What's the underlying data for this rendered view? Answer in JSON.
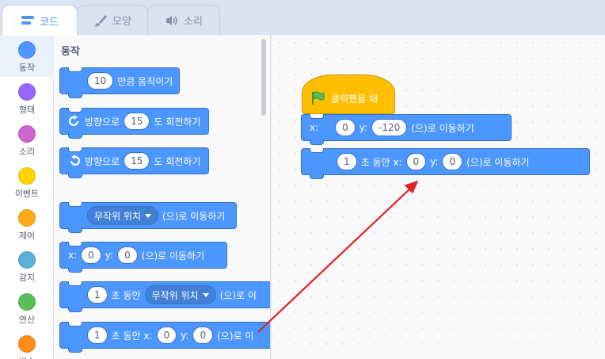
{
  "tabs": [
    {
      "label": "코드",
      "icon": "code-icon"
    },
    {
      "label": "모양",
      "icon": "brush-icon"
    },
    {
      "label": "소리",
      "icon": "speaker-icon"
    }
  ],
  "categories": [
    {
      "label": "동작",
      "color": "#4c97ff"
    },
    {
      "label": "형태",
      "color": "#9966ff"
    },
    {
      "label": "소리",
      "color": "#cf63cf"
    },
    {
      "label": "이벤트",
      "color": "#ffd500"
    },
    {
      "label": "제어",
      "color": "#ffab19"
    },
    {
      "label": "감지",
      "color": "#5cb1d6"
    },
    {
      "label": "연산",
      "color": "#59c059"
    },
    {
      "label": "변수",
      "color": "#ff8c1a"
    }
  ],
  "palette": {
    "title": "동작",
    "move": {
      "value": "10",
      "text": "만큼 움직이기"
    },
    "turn_right": {
      "pre": "방향으로",
      "value": "15",
      "post": "도 회전하기"
    },
    "turn_left": {
      "pre": "방향으로",
      "value": "15",
      "post": "도 회전하기"
    },
    "goto_random": {
      "dropdown": "무작위 위치",
      "post": "(으)로 이동하기"
    },
    "goto_xy": {
      "x_label": "x:",
      "x": "0",
      "y_label": "y:",
      "y": "0",
      "post": "(으)로 이동하기"
    },
    "glide_random": {
      "value": "1",
      "mid": "초 동안",
      "dropdown": "무작위 위치",
      "post": "(으)로 이"
    },
    "glide_xy": {
      "value": "1",
      "mid": "초 동안 x:",
      "x": "0",
      "y_label": "y:",
      "y": "0",
      "post": "(으)로 이"
    }
  },
  "script": {
    "hat_label": "클릭했을 때",
    "goto": {
      "x_label": "x:",
      "x": "0",
      "y_label": "y:",
      "y": "-120",
      "post": "(으)로 이동하기"
    },
    "glide": {
      "value": "1",
      "mid": "초 동안 x:",
      "x": "0",
      "y_label": "y:",
      "y": "0",
      "post": "(으)로 이동하기"
    }
  },
  "colors": {
    "motion": "#4c97ff",
    "events": "#ffbf00",
    "annotation_arrow": "#e0202a"
  }
}
